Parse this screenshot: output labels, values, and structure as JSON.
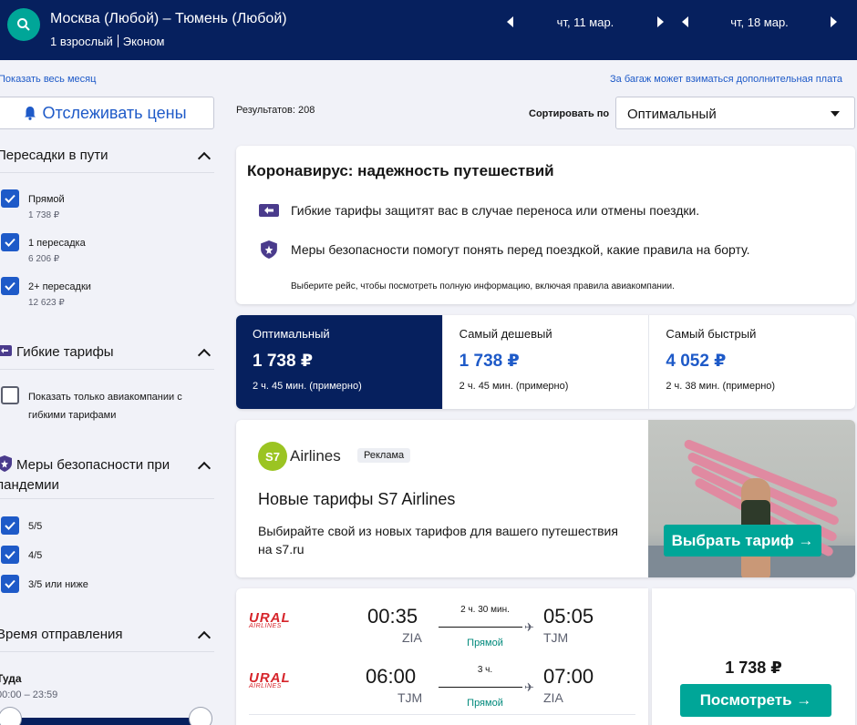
{
  "header": {
    "route": "Москва (Любой) – Тюмень (Любой)",
    "passengers": "1 взрослый",
    "cabin": "Эконом",
    "date_out": "чт, 11 мар.",
    "date_back": "чт, 18 мар."
  },
  "links": {
    "whole_month": "Показать весь месяц",
    "baggage": "За багаж может взиматься дополнительная плата"
  },
  "sidebar": {
    "track_label": "Отслеживать цены",
    "stops": {
      "title": "Пересадки в пути",
      "items": [
        {
          "label": "Прямой",
          "price": "1 738 ₽",
          "checked": true
        },
        {
          "label": "1 пересадка",
          "price": "6 206 ₽",
          "checked": true
        },
        {
          "label": "2+ пересадки",
          "price": "12 623 ₽",
          "checked": true
        }
      ]
    },
    "flex": {
      "title": "Гибкие тарифы",
      "option_line1": "Показать только авиакомпании с",
      "option_line2": "гибкими тарифами"
    },
    "safety": {
      "title_line1": "Меры безопасности при",
      "title_line2": "пандемии",
      "items": [
        "5/5",
        "4/5",
        "3/5 или ниже"
      ]
    },
    "departure": {
      "title": "Время отправления",
      "direction": "Туда",
      "range": "00:00 – 23:59"
    }
  },
  "results": {
    "count_label": "Результатов: 208",
    "sort_label": "Сортировать по",
    "sort_value": "Оптимальный"
  },
  "covid": {
    "title": "Коронавирус: надежность путешествий",
    "row1": "Гибкие тарифы защитят вас в случае переноса или отмены поездки.",
    "row2": "Меры безопасности помогут понять перед поездкой, какие правила на борту.",
    "note": "Выберите рейс, чтобы посмотреть полную информацию, включая правила авиакомпании."
  },
  "tabs": [
    {
      "title": "Оптимальный",
      "price": "1 738 ₽",
      "duration": "2 ч. 45 мин. (примерно)"
    },
    {
      "title": "Самый дешевый",
      "price": "1 738 ₽",
      "duration": "2 ч. 45 мин. (примерно)"
    },
    {
      "title": "Самый быстрый",
      "price": "4 052 ₽",
      "duration": "2 ч. 38 мин. (примерно)"
    }
  ],
  "ad": {
    "logo_mark": "S7",
    "logo_text": "Airlines",
    "badge": "Реклама",
    "headline": "Новые тарифы S7 Airlines",
    "text": "Выбирайте свой из новых тарифов для вашего путешествия на s7.ru",
    "button": "Выбрать тариф →"
  },
  "flight": {
    "airline_line1": "URAL",
    "airline_line2": "AIRLINES",
    "legs": [
      {
        "dep_time": "00:35",
        "dep_code": "ZIA",
        "duration": "2 ч. 30 мин.",
        "type": "Прямой",
        "arr_time": "05:05",
        "arr_code": "TJM"
      },
      {
        "dep_time": "06:00",
        "dep_code": "TJM",
        "duration": "3 ч.",
        "type": "Прямой",
        "arr_time": "07:00",
        "arr_code": "ZIA"
      }
    ],
    "price": "1 738 ₽",
    "button": "Посмотреть →"
  },
  "colors": {
    "navy": "#06205e",
    "teal": "#00a698",
    "blue": "#1e5ac8",
    "ural_red": "#d6252b",
    "s7_green": "#9bc422"
  }
}
